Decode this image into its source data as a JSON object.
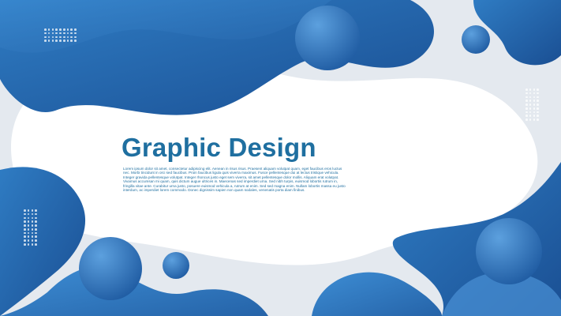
{
  "title": "Graphic Design",
  "body_text": "Lorem ipsum dolor sit amet, consectetur adipiscing elit. Aenean in risus risus. Praesent aliquam volutpat quam, eget faucibus eros luctus nec. Morbi tincidunt in orci sed faucibus. Proin faucibus ligula quis viverra maximus. Fusce pellentesque dui at lectus tristique vehicula. Integer gravida pellentesque volutpat. Integer rhoncus justo eget sem viverra, sit amet pellentesque dolor mollis. Aliquam erat volutpat. Vivamus accumsan mi quam, quis dictum augue ultrices in. Maecenas sed imperdiet urna. Sed nibh turpis, euismod lobortis rutrum in, fringilla vitae ante. Curabitur urna justo, posuere euismod vehicula a, rutrum at enim. Sed sed magna enim. Nullam lobortis massa eu justo interdum, ac imperdiet lorem commodo. Donec dignissim sapien non quam sodales, venenatis porta diam finibus.",
  "colors": {
    "primary_blue": "#1f6fa0",
    "dark_blue": "#1c5aa6",
    "light_blue": "#3f88cb",
    "pale_gray": "#e3e8ee",
    "background": "#ffffff"
  }
}
